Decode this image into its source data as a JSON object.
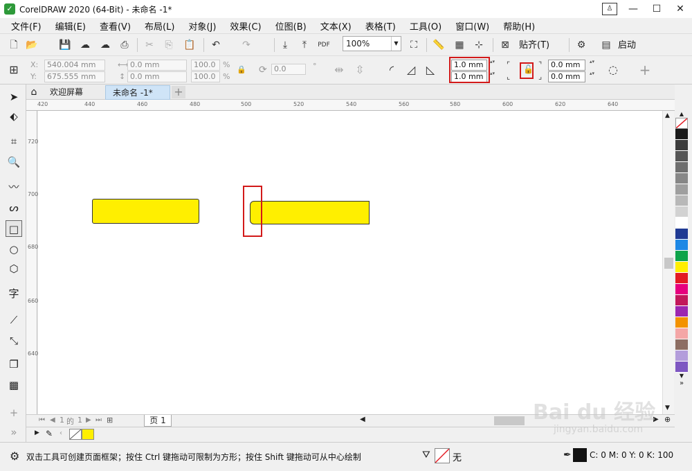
{
  "window": {
    "title": "CorelDRAW 2020 (64-Bit) - 未命名 -1*",
    "logo_icon": "coreldraw-logo-icon"
  },
  "menu": [
    "文件(F)",
    "编辑(E)",
    "查看(V)",
    "布局(L)",
    "对象(J)",
    "效果(C)",
    "位图(B)",
    "文本(X)",
    "表格(T)",
    "工具(O)",
    "窗口(W)",
    "帮助(H)"
  ],
  "toolbar": {
    "zoom": "100%",
    "snap_label": "贴齐(T)",
    "launch_label": "启动"
  },
  "property_bar": {
    "x": "540.004 mm",
    "y": "675.555 mm",
    "width": "0.0 mm",
    "height": "0.0 mm",
    "scale_w": "100.0",
    "scale_h": "100.0",
    "percent": "%",
    "rotation": "0.0",
    "rotation_unit": "°",
    "x_label": "X:",
    "y_label": "Y:",
    "corner_radius_top": "1.0 mm",
    "corner_radius_bottom": "1.0 mm",
    "corner_radius_right_top": "0.0 mm",
    "corner_radius_right_bottom": "0.0 mm",
    "lock_icon": "lock-icon",
    "highlight_color": "#d21919"
  },
  "tabs": {
    "welcome": "欢迎屏幕",
    "document": "未命名 -1*"
  },
  "ruler": {
    "h_ticks": [
      "420",
      "440",
      "460",
      "480",
      "500",
      "520",
      "540",
      "560",
      "580",
      "600",
      "620",
      "640"
    ],
    "v_ticks": [
      "720",
      "700",
      "680",
      "660",
      "640"
    ]
  },
  "canvas": {
    "shape_fill": "#ffef00",
    "shape_outline": "#333333"
  },
  "page_nav": {
    "current": "1",
    "of": "的",
    "total": "1",
    "page_tab": "页 1"
  },
  "palette": [
    "#ffffff",
    "#1a1a1a",
    "#3c3c3c",
    "#555555",
    "#6e6e6e",
    "#878787",
    "#9f9f9f",
    "#b8b8b8",
    "#d2d2d2",
    "#ffffff",
    "#1f3a93",
    "#1e88e5",
    "#0ea34a",
    "#ffee00",
    "#e31b23",
    "#e6007e",
    "#c2185b",
    "#9c27b0",
    "#f39200",
    "#f4a6a6",
    "#8d6e63",
    "#b39ddb",
    "#7e57c2"
  ],
  "status": {
    "hint": "双击工具可创建页面框架；按住 Ctrl 键拖动可限制为方形；按住 Shift 键拖动可从中心绘制",
    "fill_none": "无",
    "c": "C:",
    "c_val": "0",
    "m": "M:",
    "m_val": "0",
    "y": "Y:",
    "y_val": "0",
    "k": "K:",
    "k_val": "100"
  },
  "watermark": {
    "main": "Bai du 经验",
    "sub": "jingyan.baidu.com"
  }
}
